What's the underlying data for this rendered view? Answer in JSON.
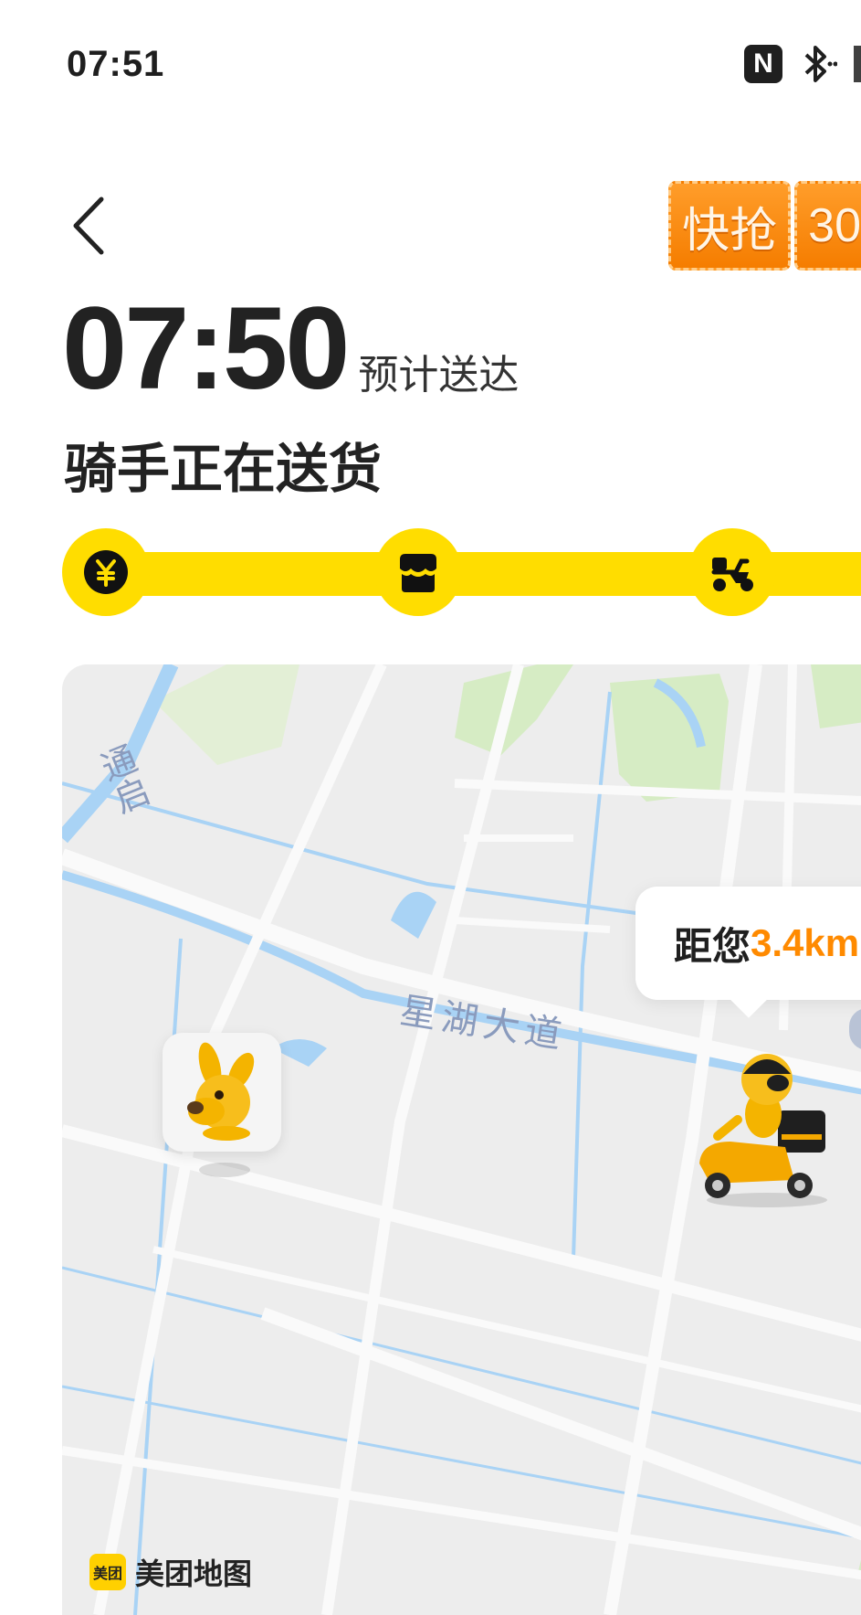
{
  "status_bar": {
    "time": "07:51",
    "nfc_label": "N",
    "icons": [
      "nfc-icon",
      "bluetooth-icon",
      "signal-icon"
    ]
  },
  "header": {
    "back_icon": "chevron-left-icon",
    "promo": {
      "label": "快抢",
      "partial_amount": "30"
    }
  },
  "eta": {
    "time": "07:50",
    "label": "预计送达"
  },
  "order_status": {
    "title": "骑手正在送货"
  },
  "progress": {
    "steps": [
      {
        "icon": "yuan-coin-icon"
      },
      {
        "icon": "store-icon"
      },
      {
        "icon": "scooter-icon"
      }
    ],
    "accent_color": "#ffdd00"
  },
  "map": {
    "distance_prefix": "距您",
    "distance_value": "3.4km",
    "road_label": "星湖大道",
    "water_label": "通启",
    "logo_badge": "美团",
    "logo_text": "美团地图",
    "user_marker_icon": "kangaroo-mascot-icon",
    "rider_marker_icon": "delivery-rider-icon",
    "colors": {
      "map_bg": "#eeeeee",
      "water": "#a9d3f5",
      "green": "#d6ecc4",
      "distance_accent": "#ff8a00"
    }
  }
}
